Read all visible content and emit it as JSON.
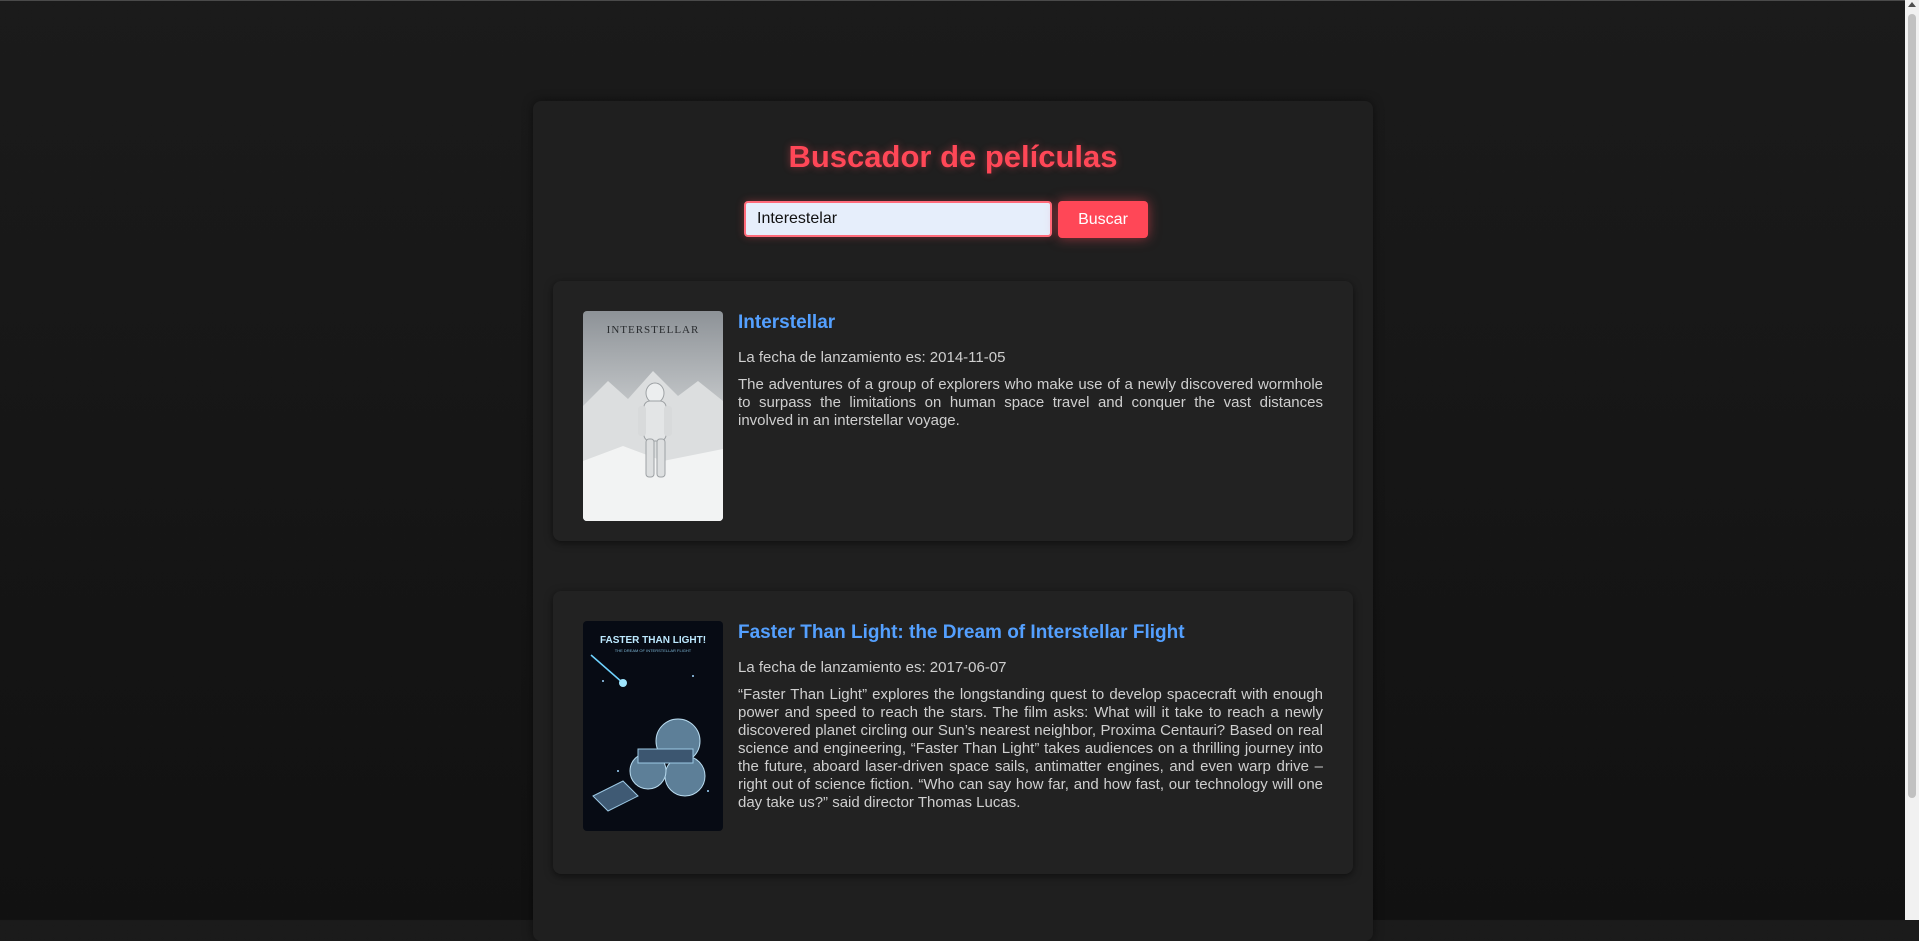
{
  "header": {
    "title": "Buscador de películas"
  },
  "search": {
    "value": "Interestelar",
    "button_label": "Buscar"
  },
  "results": [
    {
      "title": "Interstellar",
      "release": "La fecha de lanzamiento es: 2014-11-05",
      "overview": "The adventures of a group of explorers who make use of a newly discovered wormhole to surpass the limitations on human space travel and conquer the vast distances involved in an interstellar voyage.",
      "poster_text": "INTERSTELLAR"
    },
    {
      "title": "Faster Than Light: the Dream of Interstellar Flight",
      "release": "La fecha de lanzamiento es: 2017-06-07",
      "overview": "“Faster Than Light” explores the longstanding quest to develop spacecraft with enough power and speed to reach the stars. The film asks: What will it take to reach a newly discovered planet circling our Sun’s nearest neighbor, Proxima Centauri? Based on real science and engineering, “Faster Than Light” takes audiences on a thrilling journey into the future, aboard laser-driven space sails, antimatter engines, and even warp drive – right out of science fiction. “Who can say how far, and how fast, our technology will one day take us?” said director Thomas Lucas.",
      "poster_text": "FASTER THAN LIGHT!",
      "poster_subtext": "THE DREAM OF INTERSTELLAR FLIGHT"
    }
  ],
  "colors": {
    "accent": "#ff4757",
    "link": "#54a0ff",
    "card": "#222222",
    "background": "#141414"
  }
}
